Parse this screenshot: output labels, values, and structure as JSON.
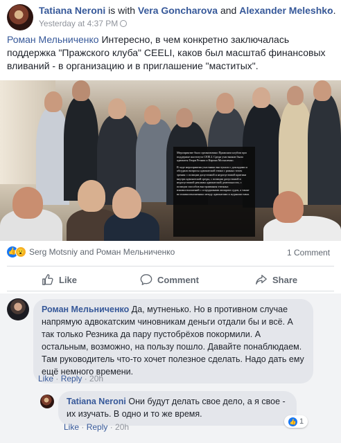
{
  "post": {
    "author": "Tatiana Neroni",
    "with_text": " is with ",
    "tagged_1": "Vera Goncharova",
    "and_text": " and ",
    "tagged_2": "Alexander Meleshko",
    "period": ".",
    "timestamp": "Yesterday at 4:37 PM",
    "more_label": "···",
    "mention": "Роман Мельниченко",
    "body": " Интересно, в чем конкретно заключалась поддержка \"Пражского клуба\" CEELI, каков был масштаб финансовых вливаний - в организацию и в приглашение \"маститых\"."
  },
  "photo_overlay": {
    "para1": "Мероприятие было организовано Пражским клубом при поддержке института CEELI. Среди участников были адвокаты Генри Резник и Карина Москаленко.",
    "para2": "В ходе мероприятия участники выступали с докладами и обсудили вопросы адвокатской этики с разных точек зрения: с позиции допустимой и недопустимой критики внутри адвокатской среды, с позиции допустимой и недопустимой рекламы адвокатской деятельности, с позиции способов выстраивания этичных взаимоотношений с сотрудниками аппарата судов, а также во взаимоотношениях между адвокатами и журналистами."
  },
  "reactions": {
    "like_glyph": "👍",
    "wow_glyph": "😮",
    "names": "Serg Motsniy and Роман Мельниченко",
    "comment_count": "1 Comment"
  },
  "actions": {
    "like": "Like",
    "comment": "Comment",
    "share": "Share"
  },
  "comments": [
    {
      "author": "Роман Мельниченко",
      "text": " Да, мутненько. Но в противном случае напрямую адвокатским чиновникам деньги отдали бы и всё. А так только Резника да пару пустобрёхов покормили. А остальным, возможно, на пользу пошло. Давайте понаблюдаем. Там руководитель что-то хочет полезное сделать. Надо дать ему ещё немного времени.",
      "like_label": "Like",
      "reply_label": "Reply",
      "sep": " · ",
      "age": "20h"
    },
    {
      "author": "Tatiana Neroni",
      "text": " Они будут делать свое дело, а я свое - их изучать. В одно и то же время.",
      "like_label": "Like",
      "reply_label": "Reply",
      "sep": " · ",
      "age": "20h",
      "reaction_count": "1"
    }
  ]
}
